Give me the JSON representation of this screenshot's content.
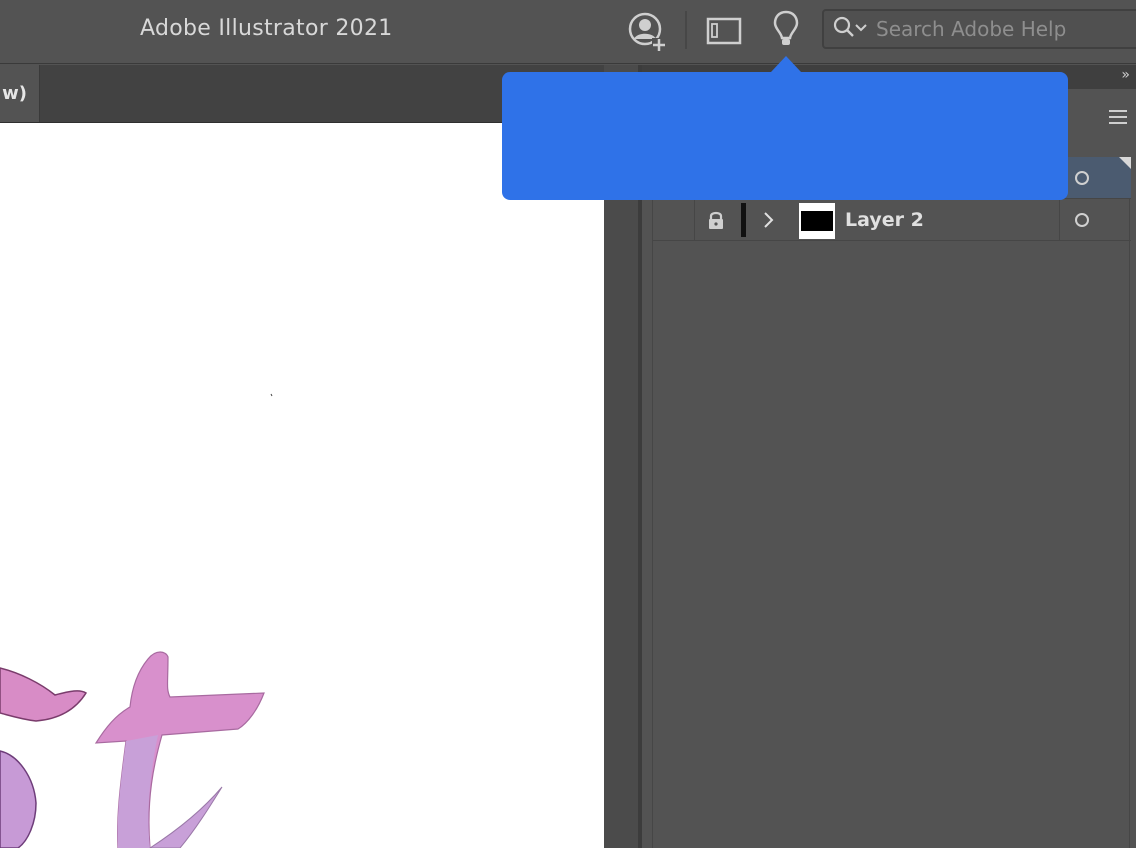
{
  "app": {
    "title": "Adobe Illustrator 2021"
  },
  "toolbar": {
    "icons": [
      "user-add-icon",
      "workspace-panel-icon",
      "lightbulb-icon"
    ]
  },
  "search": {
    "placeholder": "Search Adobe Help",
    "value": ""
  },
  "document_tab": {
    "label_fragment": "w)"
  },
  "layers": {
    "rows": [
      {
        "name": "",
        "selected": true
      },
      {
        "name": "Layer 2",
        "selected": false,
        "locked": true
      }
    ]
  },
  "colors": {
    "accent_popup": "#2f72e8",
    "selected_row": "#4b5b70",
    "panel_bg": "#535353",
    "artwork_pink": "#d88cc6",
    "artwork_lilac": "#c79ad6"
  }
}
